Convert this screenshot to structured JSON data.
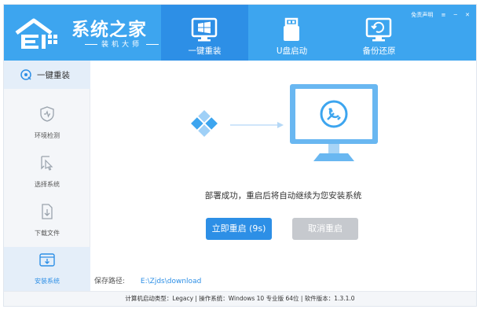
{
  "app": {
    "title": "系统之家",
    "subtitle": "装机大师"
  },
  "header": {
    "tabs": [
      {
        "label": "一键重装",
        "icon": "windows-monitor-icon",
        "active": true
      },
      {
        "label": "U盘启动",
        "icon": "usb-drive-icon",
        "active": false
      },
      {
        "label": "备份还原",
        "icon": "backup-restore-icon",
        "active": false
      }
    ],
    "links": {
      "disclaimer": "免责声明"
    },
    "window_controls": {
      "menu": "≡",
      "minimize": "─",
      "close": "✕"
    }
  },
  "sidebar": {
    "top": {
      "label": "一键重装",
      "icon": "reinstall-icon"
    },
    "items": [
      {
        "label": "环境检测",
        "icon": "shield-icon",
        "active": false
      },
      {
        "label": "选择系统",
        "icon": "cursor-select-icon",
        "active": false
      },
      {
        "label": "下载文件",
        "icon": "download-file-icon",
        "active": false
      },
      {
        "label": "安装系统",
        "icon": "install-box-icon",
        "active": true
      }
    ]
  },
  "main": {
    "message": "部署成功，重启后将自动继续为您安装系统",
    "restart_button": "立即重启 (9s)",
    "cancel_button": "取消重启",
    "save_path_label": "保存路径:",
    "save_path_value": "E:\\Zjds\\download"
  },
  "status_bar": {
    "text": "计算机启动类型：Legacy | 操作系统：Windows 10 专业版 64位 | 软件版本：1.3.1.0"
  },
  "colors": {
    "brand": "#3da5ef",
    "active_tab": "#2d8fe6",
    "button_primary": "#2d8fe6",
    "button_disabled": "#c6c9ce"
  }
}
